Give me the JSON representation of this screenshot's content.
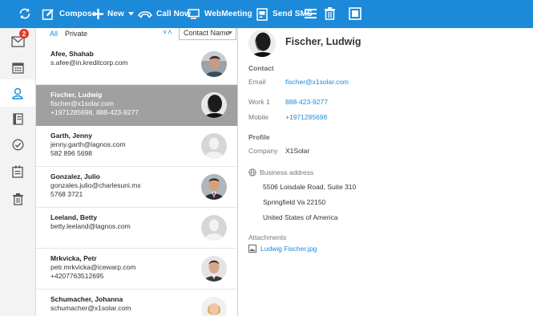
{
  "toolbar": {
    "compose": "Compose",
    "new": "New",
    "call_now": "Call Now",
    "web_meeting": "WebMeeting",
    "send_sms": "Send SMS"
  },
  "leftnav": {
    "mail_badge": "2"
  },
  "filter": {
    "all": "All",
    "private": "Private",
    "sort_direction": "˅˄",
    "sort_field": "Contact Name"
  },
  "contacts": [
    {
      "name": "Afee, Shahab",
      "email": "s.afee@in.kreditcorp.com",
      "phone": ""
    },
    {
      "name": "Fischer, Ludwig",
      "email": "fischer@x1solar.com",
      "phone": "+1971285698, 888-423-9277"
    },
    {
      "name": "Garth, Jenny",
      "email": "jenny.garth@lagnos.com",
      "phone": "582 896 5698"
    },
    {
      "name": "Gonzalez, Julio",
      "email": "gonzales.julio@charlesuni.mx",
      "phone": "5768 3721"
    },
    {
      "name": "Leeland, Betty",
      "email": "betty.leeland@lagnos.com",
      "phone": ""
    },
    {
      "name": "Mrkvicka, Petr",
      "email": "petr.mrkvicka@icewarp.com",
      "phone": "+4207763512695"
    },
    {
      "name": "Schumacher, Johanna",
      "email": "schumacher@x1solar.com",
      "phone": ""
    }
  ],
  "detail": {
    "name": "Fischer, Ludwig",
    "contact_heading": "Contact",
    "email_label": "Email",
    "email": "fischer@x1solar.com",
    "work_label": "Work 1",
    "work": "888-423-9277",
    "mobile_label": "Mobile",
    "mobile": "+1971285698",
    "profile_heading": "Profile",
    "company_label": "Company",
    "company": "X1Solar",
    "address_heading": "Business address",
    "address_line1": "5506 Loisdale Road, Suite 310",
    "address_line2": "Springfield Va 22150",
    "address_line3": "United States of America",
    "attachments_heading": "Attachments",
    "attachment": "Ludwig Fischer.jpg"
  },
  "colors": {
    "accent": "#1c8ad8",
    "selected_row": "#a0a0a0",
    "badge": "#e03b2f"
  }
}
